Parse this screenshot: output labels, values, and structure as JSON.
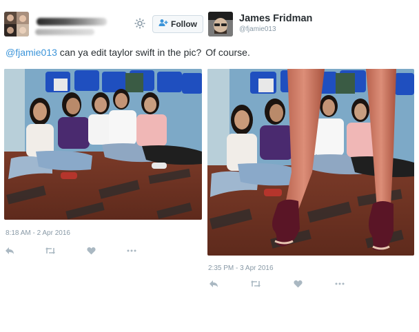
{
  "left_tweet": {
    "follow_label": "Follow",
    "text_mention": "@fjamie013",
    "text_body": " can ya edit taylor swift in the pic?",
    "timestamp": "8:18 AM - 2 Apr 2016",
    "icons": [
      "avatar-collage",
      "gear-icon",
      "add-user-icon",
      "reply-icon",
      "retweet-icon",
      "like-icon",
      "more-icon"
    ]
  },
  "right_tweet": {
    "author_name": "James Fridman",
    "author_handle": "@fjamie013",
    "reply_text": "Of course.",
    "timestamp": "2:35 PM - 3 Apr 2016",
    "icons": [
      "reply-icon",
      "retweet-icon",
      "like-icon",
      "more-icon"
    ]
  },
  "colors": {
    "mention": "#3b94d9",
    "text": "#292f33",
    "muted": "#8899a6",
    "action_icon": "#aab8c2",
    "button_bg": "#f5f8fa"
  }
}
